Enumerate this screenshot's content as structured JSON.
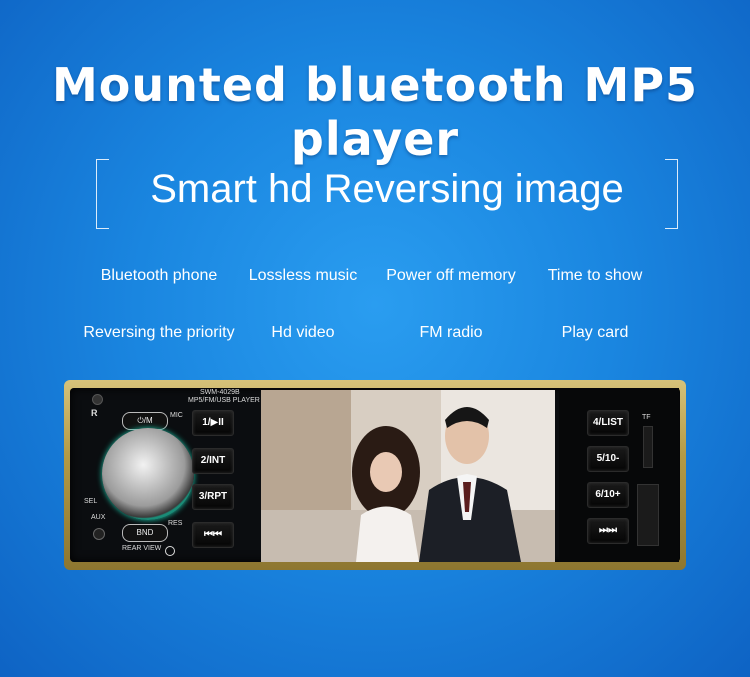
{
  "title": "Mounted bluetooth MP5 player",
  "subtitle": "Smart hd  Reversing image",
  "features": [
    "Bluetooth phone",
    "Lossless music",
    "Power off memory",
    "Time to show",
    "Reversing the priority",
    "Hd video",
    "FM radio",
    "Play card"
  ],
  "device": {
    "model": "SWM-4029B",
    "sub_model": "MP5/FM/USB PLAYER",
    "left_labels": {
      "mic": "MIC",
      "sel": "SEL",
      "aux": "AUX",
      "res": "RES",
      "rear_view": "REAR VIEW",
      "r": "R"
    },
    "knob_buttons": {
      "top": "⏻/M",
      "bottom": "BND"
    },
    "left_buttons": [
      "1/▶II",
      "2/INT",
      "3/RPT",
      "⏮⏮"
    ],
    "right_buttons": [
      "4/LIST",
      "5/10-",
      "6/10+",
      "⏭⏭"
    ],
    "tf_label": "TF"
  }
}
